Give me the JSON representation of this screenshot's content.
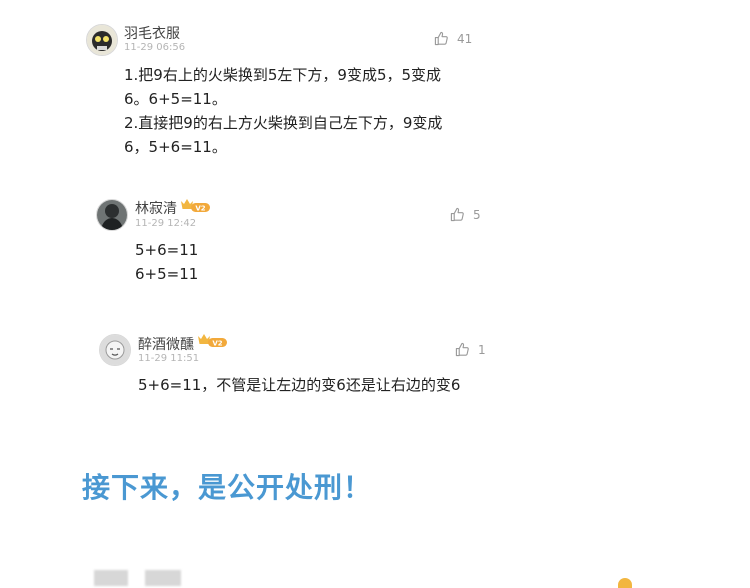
{
  "comments": [
    {
      "username": "羽毛衣服",
      "time": "11-29 06:56",
      "likes": "41",
      "lines": [
        "1.把9右上的火柴换到5左下方，9变成5，5变成",
        "6。6+5=11。",
        "2.直接把9的右上方火柴换到自己左下方，9变成",
        "6，5+6=11。"
      ]
    },
    {
      "username": "林寂清",
      "time": "11-29 12:42",
      "likes": "5",
      "badge": "V2",
      "lines": [
        "5+6=11",
        "6+5=11"
      ]
    },
    {
      "username": "醉酒微醺",
      "time": "11-29 11:51",
      "likes": "1",
      "badge": "V2",
      "lines": [
        "5+6=11，不管是让左边的变6还是让右边的变6"
      ]
    }
  ],
  "headline": "接下来，是公开处刑！",
  "icons": {
    "like": "thumbs-up-icon",
    "vip": "crown-vip-badge-icon"
  },
  "colors": {
    "headline": "#4a98d2",
    "badge": "#f2a93b"
  }
}
